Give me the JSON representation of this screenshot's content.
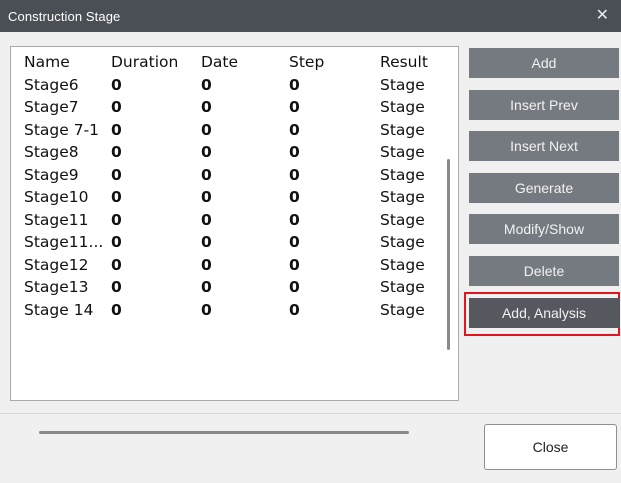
{
  "window": {
    "title": "Construction Stage",
    "close_glyph": "✕"
  },
  "table": {
    "columns": [
      "Name",
      "Duration",
      "Date",
      "Step",
      "Result"
    ],
    "rows": [
      [
        "Stage6",
        "0",
        "0",
        "0",
        "Stage"
      ],
      [
        "Stage7",
        "0",
        "0",
        "0",
        "Stage"
      ],
      [
        "Stage 7-1",
        "0",
        "0",
        "0",
        "Stage"
      ],
      [
        "Stage8",
        "0",
        "0",
        "0",
        "Stage"
      ],
      [
        "Stage9",
        "0",
        "0",
        "0",
        "Stage"
      ],
      [
        "Stage10",
        "0",
        "0",
        "0",
        "Stage"
      ],
      [
        "Stage11",
        "0",
        "0",
        "0",
        "Stage"
      ],
      [
        "Stage11...",
        "0",
        "0",
        "0",
        "Stage"
      ],
      [
        "Stage12",
        "0",
        "0",
        "0",
        "Stage"
      ],
      [
        "Stage13",
        "0",
        "0",
        "0",
        "Stage"
      ],
      [
        "Stage 14",
        "0",
        "0",
        "0",
        "Stage"
      ]
    ]
  },
  "buttons": {
    "add": "Add",
    "insert_prev": "Insert Prev",
    "insert_next": "Insert Next",
    "generate": "Generate",
    "modify_show": "Modify/Show",
    "delete": "Delete",
    "add_analysis": "Add, Analysis"
  },
  "footer": {
    "close": "Close"
  },
  "colors": {
    "titlebar": "#4a4f56",
    "button": "#757a80",
    "button_selected": "#55595f",
    "highlight": "#e0161e"
  }
}
